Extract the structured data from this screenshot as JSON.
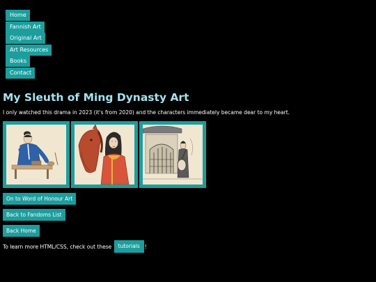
{
  "nav": {
    "items": [
      {
        "label": "Home"
      },
      {
        "label": "Fannish Art"
      },
      {
        "label": "Original Art"
      },
      {
        "label": "Art Resources"
      },
      {
        "label": "Books"
      },
      {
        "label": "Contact"
      }
    ]
  },
  "main": {
    "title": "My Sleuth of Ming Dynasty Art",
    "intro": "I only watched this drama in 2023 (it's from 2020) and the characters immediately became dear to my heart."
  },
  "buttons": {
    "next": "On to Word of Honour Art",
    "fandoms": "Back to Fandoms List",
    "home": "Back Home"
  },
  "footer": {
    "prefix": "To learn more HTML/CSS, check out these",
    "link": "tutorials",
    "suffix": "!"
  },
  "colors": {
    "accent": "#1c9e9e",
    "title": "#a4e2ee",
    "background": "#000000",
    "paper": "#f1e7d1"
  }
}
